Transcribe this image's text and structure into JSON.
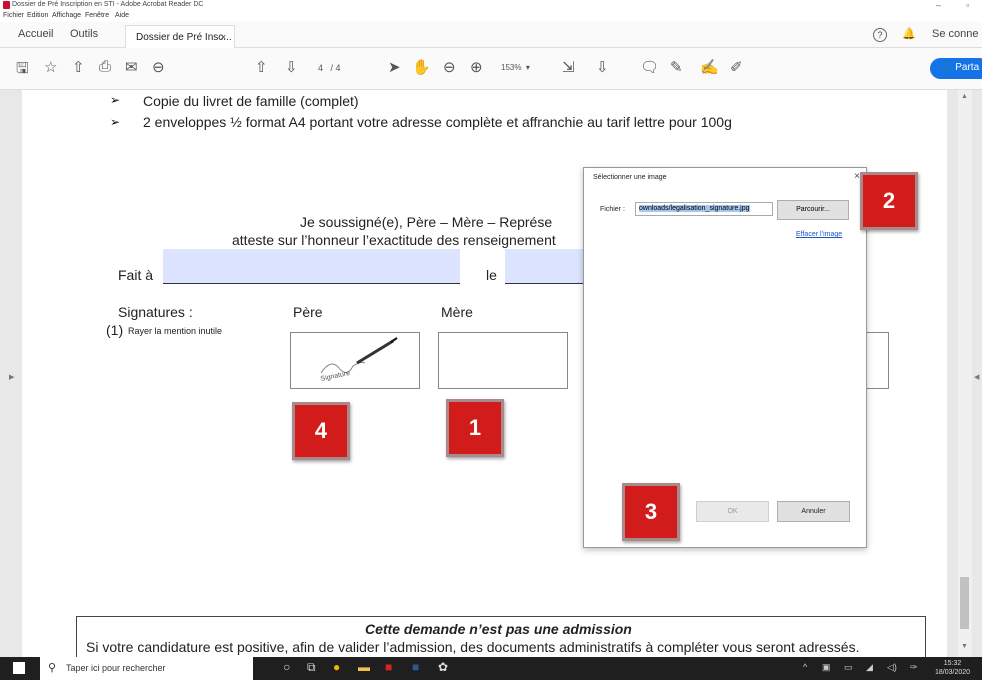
{
  "window": {
    "title": "Dossier de Pré Inscription en STI - Adobe Acrobat Reader DC",
    "minimize": "–",
    "restore": "▫"
  },
  "menu": [
    "Fichier",
    "Edition",
    "Affichage",
    "Fenêtre",
    "Aide"
  ],
  "tabs": {
    "home": "Accueil",
    "tools": "Outils",
    "document": "Dossier de Pré Insc...",
    "close": "×",
    "help": "?",
    "bell": "🔔",
    "signin": "Se conne"
  },
  "toolbar": {
    "current_page": "4",
    "page_sep": "/ 4",
    "zoom": "153%",
    "zoom_arrow": "▾",
    "share": "Parta",
    "icons": [
      "save-icon",
      "bookmark-star-icon",
      "upload-icon",
      "print-icon",
      "email-icon",
      "zoom-out-search-icon",
      "page-up-icon",
      "page-down-icon",
      "select-cursor-icon",
      "hand-tool-icon",
      "zoom-minus-icon",
      "zoom-plus-icon",
      "fit-page-icon",
      "scroll-mode-icon",
      "comment-icon",
      "highlight-icon",
      "sign-icon",
      "fill-sign-icon"
    ]
  },
  "document": {
    "bullet_1": "Copie du livret de famille (complet)",
    "bullet_2": "2 enveloppes ½ format A4 portant votre adresse complète et affranchie au tarif lettre pour 100g",
    "attest_1": "Je soussigné(e), Père – Mère – Représe",
    "attest_2": "atteste sur l’honneur l’exactitude des renseignement",
    "fait_a": "Fait à",
    "le": "le",
    "signatures": "Signatures :",
    "rayer_num": "(1)",
    "rayer": "Rayer la mention inutile",
    "pere": "Père",
    "mere": "Mère",
    "signature_word": "Signature",
    "footer_title": "Cette demande n’est pas une admission",
    "footer_text": "Si votre candidature est positive, afin de valider l’admission, des documents administratifs à compléter vous seront adressés."
  },
  "dialog": {
    "title": "Sélectionner une image",
    "close": "×",
    "file_label": "Fichier :",
    "file_value": "ownloads/legalisation_signature.jpg",
    "browse": "Parcourir...",
    "clear": "Effacer l’image",
    "ok": "OK",
    "cancel": "Annuler"
  },
  "markers": [
    "2",
    "3",
    "1",
    "4"
  ],
  "taskbar": {
    "search_placeholder": "Taper ici pour rechercher",
    "time": "15:32",
    "date": "18/03/2020"
  },
  "colors": {
    "accent_share": "#1473e6",
    "marker_red": "#d21b1b",
    "field_fill": "#dde4ff",
    "link_blue": "#1a55c8"
  }
}
